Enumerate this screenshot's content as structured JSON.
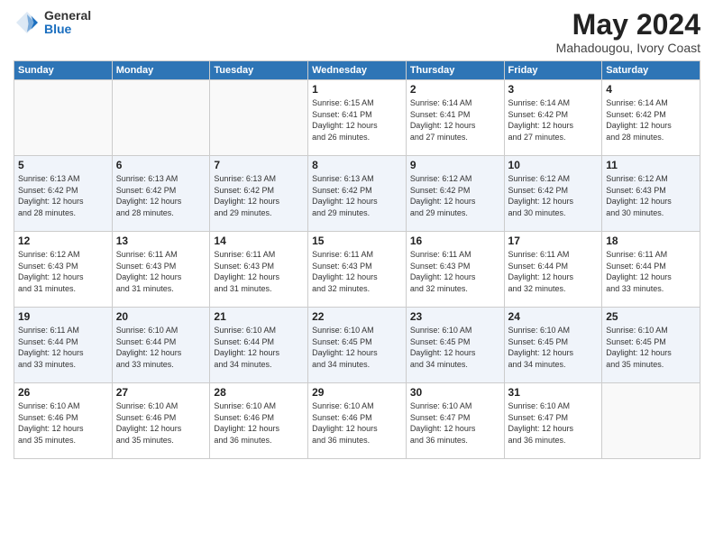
{
  "logo": {
    "general": "General",
    "blue": "Blue"
  },
  "title": "May 2024",
  "location": "Mahadougou, Ivory Coast",
  "days_of_week": [
    "Sunday",
    "Monday",
    "Tuesday",
    "Wednesday",
    "Thursday",
    "Friday",
    "Saturday"
  ],
  "weeks": [
    [
      {
        "day": "",
        "text": ""
      },
      {
        "day": "",
        "text": ""
      },
      {
        "day": "",
        "text": ""
      },
      {
        "day": "1",
        "text": "Sunrise: 6:15 AM\nSunset: 6:41 PM\nDaylight: 12 hours\nand 26 minutes."
      },
      {
        "day": "2",
        "text": "Sunrise: 6:14 AM\nSunset: 6:41 PM\nDaylight: 12 hours\nand 27 minutes."
      },
      {
        "day": "3",
        "text": "Sunrise: 6:14 AM\nSunset: 6:42 PM\nDaylight: 12 hours\nand 27 minutes."
      },
      {
        "day": "4",
        "text": "Sunrise: 6:14 AM\nSunset: 6:42 PM\nDaylight: 12 hours\nand 28 minutes."
      }
    ],
    [
      {
        "day": "5",
        "text": "Sunrise: 6:13 AM\nSunset: 6:42 PM\nDaylight: 12 hours\nand 28 minutes."
      },
      {
        "day": "6",
        "text": "Sunrise: 6:13 AM\nSunset: 6:42 PM\nDaylight: 12 hours\nand 28 minutes."
      },
      {
        "day": "7",
        "text": "Sunrise: 6:13 AM\nSunset: 6:42 PM\nDaylight: 12 hours\nand 29 minutes."
      },
      {
        "day": "8",
        "text": "Sunrise: 6:13 AM\nSunset: 6:42 PM\nDaylight: 12 hours\nand 29 minutes."
      },
      {
        "day": "9",
        "text": "Sunrise: 6:12 AM\nSunset: 6:42 PM\nDaylight: 12 hours\nand 29 minutes."
      },
      {
        "day": "10",
        "text": "Sunrise: 6:12 AM\nSunset: 6:42 PM\nDaylight: 12 hours\nand 30 minutes."
      },
      {
        "day": "11",
        "text": "Sunrise: 6:12 AM\nSunset: 6:43 PM\nDaylight: 12 hours\nand 30 minutes."
      }
    ],
    [
      {
        "day": "12",
        "text": "Sunrise: 6:12 AM\nSunset: 6:43 PM\nDaylight: 12 hours\nand 31 minutes."
      },
      {
        "day": "13",
        "text": "Sunrise: 6:11 AM\nSunset: 6:43 PM\nDaylight: 12 hours\nand 31 minutes."
      },
      {
        "day": "14",
        "text": "Sunrise: 6:11 AM\nSunset: 6:43 PM\nDaylight: 12 hours\nand 31 minutes."
      },
      {
        "day": "15",
        "text": "Sunrise: 6:11 AM\nSunset: 6:43 PM\nDaylight: 12 hours\nand 32 minutes."
      },
      {
        "day": "16",
        "text": "Sunrise: 6:11 AM\nSunset: 6:43 PM\nDaylight: 12 hours\nand 32 minutes."
      },
      {
        "day": "17",
        "text": "Sunrise: 6:11 AM\nSunset: 6:44 PM\nDaylight: 12 hours\nand 32 minutes."
      },
      {
        "day": "18",
        "text": "Sunrise: 6:11 AM\nSunset: 6:44 PM\nDaylight: 12 hours\nand 33 minutes."
      }
    ],
    [
      {
        "day": "19",
        "text": "Sunrise: 6:11 AM\nSunset: 6:44 PM\nDaylight: 12 hours\nand 33 minutes."
      },
      {
        "day": "20",
        "text": "Sunrise: 6:10 AM\nSunset: 6:44 PM\nDaylight: 12 hours\nand 33 minutes."
      },
      {
        "day": "21",
        "text": "Sunrise: 6:10 AM\nSunset: 6:44 PM\nDaylight: 12 hours\nand 34 minutes."
      },
      {
        "day": "22",
        "text": "Sunrise: 6:10 AM\nSunset: 6:45 PM\nDaylight: 12 hours\nand 34 minutes."
      },
      {
        "day": "23",
        "text": "Sunrise: 6:10 AM\nSunset: 6:45 PM\nDaylight: 12 hours\nand 34 minutes."
      },
      {
        "day": "24",
        "text": "Sunrise: 6:10 AM\nSunset: 6:45 PM\nDaylight: 12 hours\nand 34 minutes."
      },
      {
        "day": "25",
        "text": "Sunrise: 6:10 AM\nSunset: 6:45 PM\nDaylight: 12 hours\nand 35 minutes."
      }
    ],
    [
      {
        "day": "26",
        "text": "Sunrise: 6:10 AM\nSunset: 6:46 PM\nDaylight: 12 hours\nand 35 minutes."
      },
      {
        "day": "27",
        "text": "Sunrise: 6:10 AM\nSunset: 6:46 PM\nDaylight: 12 hours\nand 35 minutes."
      },
      {
        "day": "28",
        "text": "Sunrise: 6:10 AM\nSunset: 6:46 PM\nDaylight: 12 hours\nand 36 minutes."
      },
      {
        "day": "29",
        "text": "Sunrise: 6:10 AM\nSunset: 6:46 PM\nDaylight: 12 hours\nand 36 minutes."
      },
      {
        "day": "30",
        "text": "Sunrise: 6:10 AM\nSunset: 6:47 PM\nDaylight: 12 hours\nand 36 minutes."
      },
      {
        "day": "31",
        "text": "Sunrise: 6:10 AM\nSunset: 6:47 PM\nDaylight: 12 hours\nand 36 minutes."
      },
      {
        "day": "",
        "text": ""
      }
    ]
  ]
}
